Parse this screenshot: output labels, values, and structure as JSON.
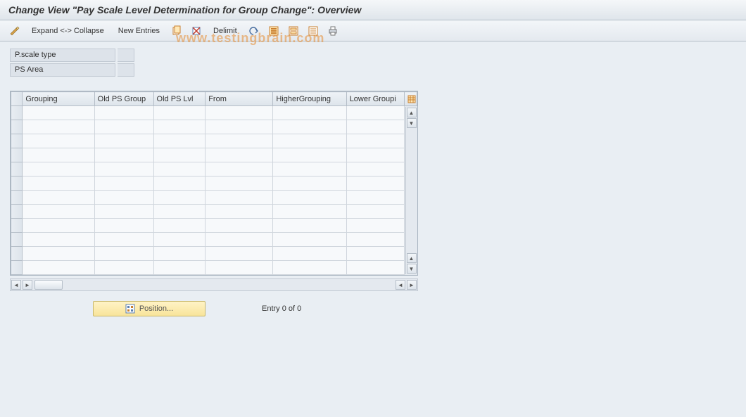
{
  "header": {
    "title": "Change View \"Pay Scale Level Determination for Group Change\": Overview"
  },
  "toolbar": {
    "expand_collapse": "Expand <-> Collapse",
    "new_entries": "New Entries",
    "delimit": "Delimit"
  },
  "form": {
    "pscale_type_label": "P.scale type",
    "pscale_type_value": "",
    "ps_area_label": "PS Area",
    "ps_area_value": ""
  },
  "table": {
    "columns": [
      "Grouping",
      "Old PS Group",
      "Old PS Lvl",
      "From",
      "HigherGrouping",
      "Lower Groupi"
    ],
    "row_count": 12
  },
  "footer": {
    "position_label": "Position...",
    "entry_text": "Entry 0 of 0"
  },
  "watermark": "www.testingbrain.com"
}
